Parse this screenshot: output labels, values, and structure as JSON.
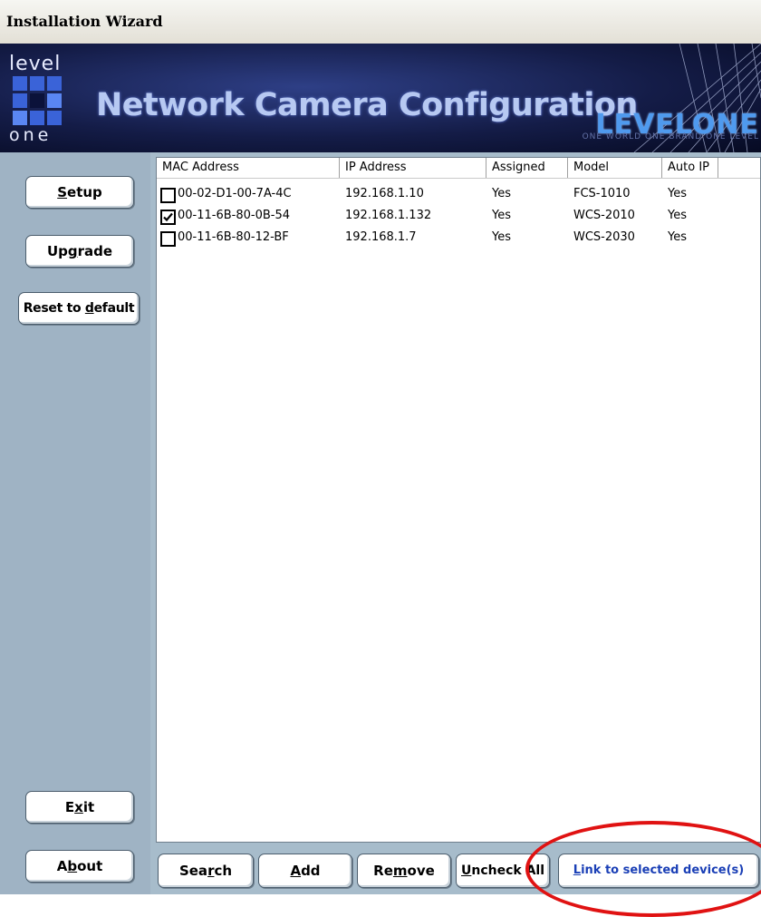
{
  "window": {
    "title": "Installation Wizard"
  },
  "banner": {
    "logo_top": "level",
    "logo_bottom": "one",
    "title": "Network Camera Configuration",
    "brand": "LEVELONE",
    "tagline": "ONE WORLD  ONE BRAND  ONE LEVEL"
  },
  "sidebar": {
    "setup": {
      "pre": "",
      "key": "S",
      "post": "etup"
    },
    "upgrade": {
      "pre": "Up",
      "key": "g",
      "post": "rade"
    },
    "reset": {
      "pre": "Reset to ",
      "key": "d",
      "post": "efault"
    },
    "exit": {
      "pre": "E",
      "key": "x",
      "post": "it"
    },
    "about": {
      "pre": "A",
      "key": "b",
      "post": "out"
    }
  },
  "table": {
    "columns": [
      "MAC Address",
      "IP Address",
      "Assigned",
      "Model",
      "Auto IP"
    ],
    "rows": [
      {
        "checked": false,
        "mac": "00-02-D1-00-7A-4C",
        "ip": "192.168.1.10",
        "assigned": "Yes",
        "model": "FCS-1010",
        "auto_ip": "Yes"
      },
      {
        "checked": true,
        "mac": "00-11-6B-80-0B-54",
        "ip": "192.168.1.132",
        "assigned": "Yes",
        "model": "WCS-2010",
        "auto_ip": "Yes"
      },
      {
        "checked": false,
        "mac": "00-11-6B-80-12-BF",
        "ip": "192.168.1.7",
        "assigned": "Yes",
        "model": "WCS-2030",
        "auto_ip": "Yes"
      }
    ]
  },
  "bottom_buttons": {
    "search": {
      "pre": "Sea",
      "key": "r",
      "post": "ch"
    },
    "add": {
      "pre": "",
      "key": "A",
      "post": "dd"
    },
    "remove": {
      "pre": "Re",
      "key": "m",
      "post": "ove"
    },
    "uncheck": {
      "pre": "",
      "key": "U",
      "post": "ncheck All"
    },
    "link": {
      "pre": "",
      "key": "L",
      "post": "ink to selected device(s)"
    }
  },
  "colors": {
    "annotation": "#e01212",
    "link_text": "#1a3fb6",
    "banner_brand": "#4f9aee"
  }
}
